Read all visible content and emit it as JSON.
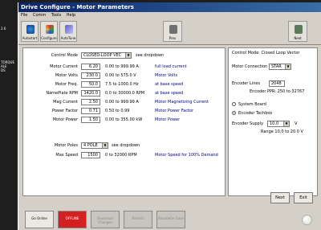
{
  "background": {
    "lines": [
      "2.6",
      "TORQUE",
      "ALE",
      "DS"
    ]
  },
  "window": {
    "title": "Drive Configure - Motor Parameters"
  },
  "menu": [
    "File",
    "Comm",
    "Tools",
    "Help"
  ],
  "toolbar": [
    {
      "label": "Autostart",
      "icon": "autostart-icon"
    },
    {
      "label": "Configure",
      "icon": "configure-icon"
    },
    {
      "label": "AutoTune",
      "icon": "autotune-icon"
    }
  ],
  "toolbar_buttons": {
    "prev": "Prev",
    "next": "Next"
  },
  "control_mode": {
    "label": "Control Mode",
    "value": "CLOSED-LOOP VEC",
    "note": "see dropdown"
  },
  "params": [
    {
      "label": "Motor Current",
      "value": "6.20",
      "range": "0.00 to 999.99 A",
      "desc": "full load current"
    },
    {
      "label": "Motor Volts",
      "value": "230.0",
      "range": "0.00 to 575.0 V",
      "desc": "Motor Volts"
    },
    {
      "label": "Motor Freq.",
      "value": "50.0",
      "range": "7.5 to 1000.0 Hz",
      "desc": "at base speed"
    },
    {
      "label": "NamePlate RPM",
      "value": "1420.0",
      "range": "0.0 to 30000.0 RPM",
      "desc": "at base speed"
    },
    {
      "label": "Mag Current",
      "value": "2.50",
      "range": "0.00 to 999.99 A",
      "desc": "Motor Magnetizing Current"
    },
    {
      "label": "Power Factor",
      "value": "0.71",
      "range": "0.50 to 0.99",
      "desc": "Motor Power Factor"
    },
    {
      "label": "Motor Power",
      "value": "1.50",
      "range": "0.00 to 355.00 kW",
      "desc": "Motor Power"
    }
  ],
  "motor_poles": {
    "label": "Motor Poles",
    "value": "4 POLE",
    "note": "see dropdown"
  },
  "max_speed": {
    "label": "Max Speed",
    "value": "1500",
    "range": "0 to 32000 RPM",
    "desc": "Motor Speed for 100% Demand"
  },
  "right_panel": {
    "header": "Control Mode: Closed Loop Vector",
    "motor_connection": {
      "label": "Motor Connection",
      "value": "STAR"
    },
    "encoder_lines": {
      "label": "Encoder Lines",
      "value": "2048",
      "note": "Encoder PPR: 250 to 32767"
    },
    "radio_system_board": "System Board",
    "radio_encoder_techbox": "Encoder Techbox",
    "encoder_supply": {
      "label": "Encoder Supply",
      "value": "10.0",
      "unit": "V",
      "range": "Range 10.0 to 20.0 V"
    }
  },
  "nav": {
    "next": "Next",
    "exit": "Exit"
  },
  "bottom": [
    {
      "label": "Go Online"
    },
    {
      "label": "OFFLINE"
    },
    {
      "label": "Download Changes"
    },
    {
      "label": "Refresh"
    },
    {
      "label": "Parameter Save"
    }
  ],
  "colors": {
    "offline": "#d42020",
    "title_start": "#0a246a",
    "title_end": "#3a6ea5",
    "desc": "#000080"
  }
}
